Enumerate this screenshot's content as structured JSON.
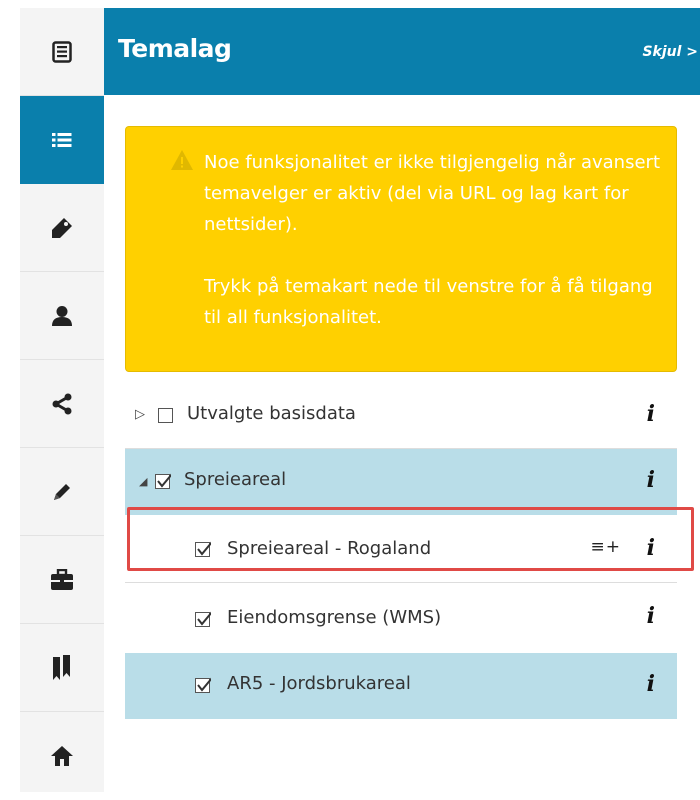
{
  "header": {
    "title": "Temalag",
    "hide_label": "Skjul >"
  },
  "sidebar": {
    "items": [
      {
        "icon": "document-icon",
        "active": false
      },
      {
        "icon": "list-icon",
        "active": true
      },
      {
        "icon": "tag-icon",
        "active": false
      },
      {
        "icon": "user-icon",
        "active": false
      },
      {
        "icon": "share-icon",
        "active": false
      },
      {
        "icon": "pencil-icon",
        "active": false
      },
      {
        "icon": "briefcase-icon",
        "active": false
      },
      {
        "icon": "bookmark-icon",
        "active": false
      },
      {
        "icon": "home-icon",
        "active": false
      }
    ]
  },
  "warning": {
    "icon": "warning-icon",
    "paragraph1": "Noe funksjonalitet er ikke tilgjengelig når avansert temavelger er aktiv (del via URL og lag kart for nettsider).",
    "paragraph2": "Trykk på temakart nede til venstre for å få tilgang til all funksjonalitet."
  },
  "layers": [
    {
      "label": "Utvalgte basisdata",
      "checked": false,
      "expander": "▷",
      "info": "i"
    },
    {
      "label": "Spreieareal",
      "checked": true,
      "expander": "◢",
      "info": "i"
    },
    {
      "label": "Spreieareal - Rogaland",
      "checked": true,
      "legend_icon": "≡+",
      "info": "i"
    },
    {
      "label": "Eiendomsgrense (WMS)",
      "checked": true,
      "info": "i"
    },
    {
      "label": "AR5 - Jordsbrukareal",
      "checked": true,
      "info": "i"
    }
  ],
  "colors": {
    "accent": "#0a7fac",
    "warning": "#ffd000",
    "selected_row": "#b9dde8",
    "highlight": "#e04a46"
  }
}
